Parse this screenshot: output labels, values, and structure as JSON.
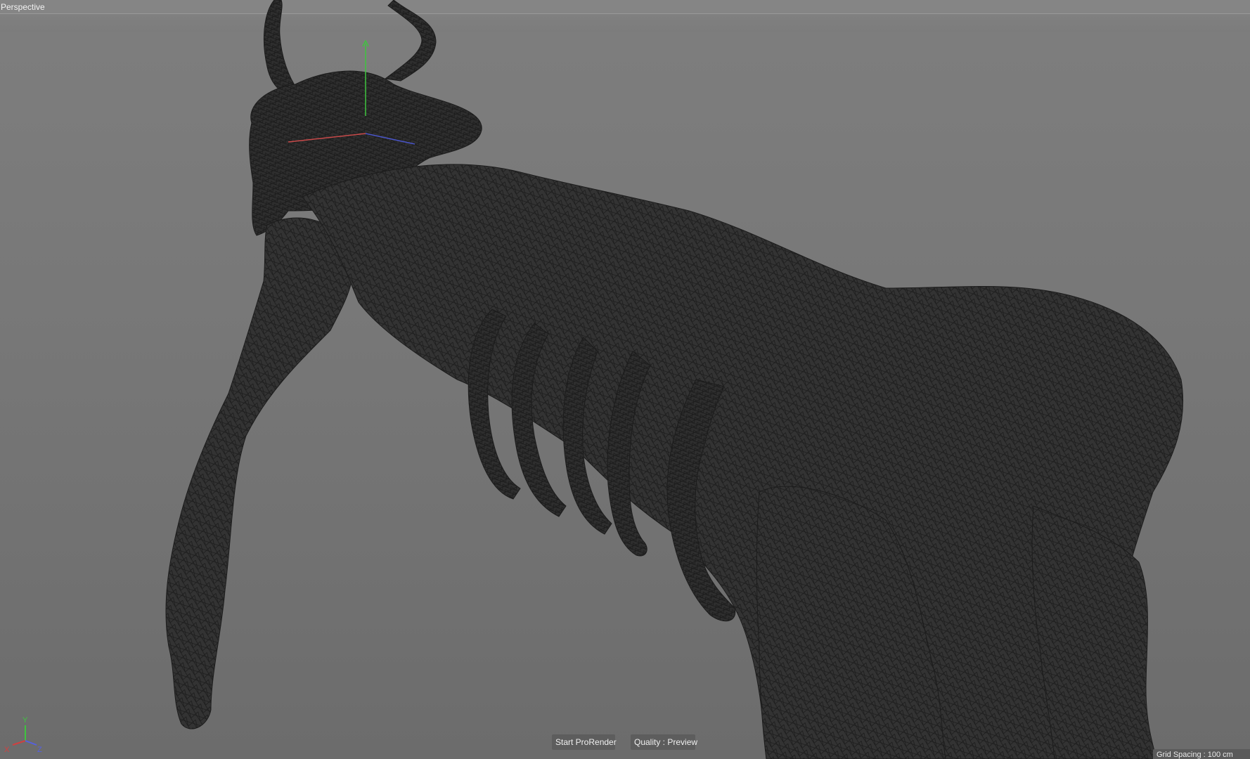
{
  "viewport": {
    "view_name": "Perspective",
    "background_top": "#7e7e7e",
    "background_bottom": "#6c6c6c",
    "mesh_fill": "#2f2f2f",
    "wire_color": "#1c1c1c"
  },
  "axis_gizmo": {
    "x_label": "X",
    "y_label": "Y",
    "z_label": "Z",
    "x_color": "#d04040",
    "y_color": "#3fc43f",
    "z_color": "#5560e0"
  },
  "hud": {
    "start_prorender_label": "Start ProRender",
    "quality_label": "Quality : Preview",
    "grid_spacing": "Grid Spacing : 100 cm"
  }
}
